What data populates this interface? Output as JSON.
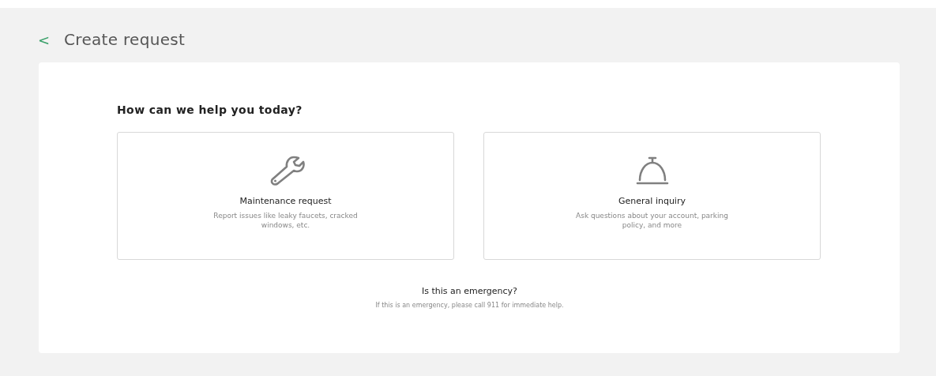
{
  "header": {
    "back": "<",
    "title": "Create request"
  },
  "prompt": "How can we help you today?",
  "options": [
    {
      "kind": "wrench",
      "title": "Maintenance request",
      "description": "Report issues like leaky faucets, cracked windows, etc."
    },
    {
      "kind": "bell",
      "title": "General inquiry",
      "description": "Ask questions about your account, parking policy, and more"
    }
  ],
  "emergency": {
    "title": "Is this an emergency?",
    "text": "If this is an emergency, please call 911 for immediate help."
  }
}
